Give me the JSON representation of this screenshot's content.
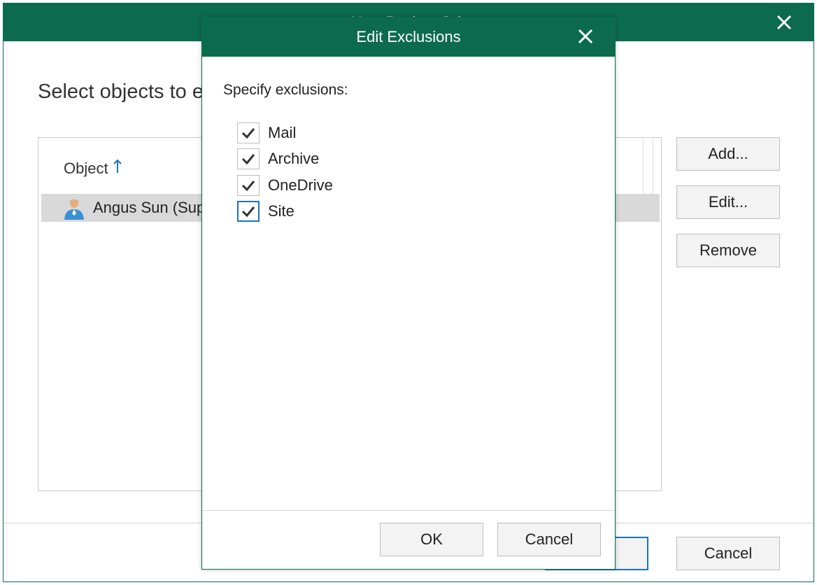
{
  "outer_window": {
    "title": "New Backup Job",
    "heading": "Select objects to e",
    "table": {
      "column_header": "Object",
      "sort_direction": "ascending",
      "rows": [
        {
          "icon": "user-icon",
          "label": "Angus Sun (Sup"
        }
      ]
    },
    "side_buttons": {
      "add": "Add...",
      "edit": "Edit...",
      "remove": "Remove"
    },
    "footer": {
      "cancel": "Cancel"
    }
  },
  "modal": {
    "title": "Edit Exclusions",
    "prompt": "Specify exclusions:",
    "items": [
      {
        "label": "Mail",
        "checked": true
      },
      {
        "label": "Archive",
        "checked": true
      },
      {
        "label": "OneDrive",
        "checked": true
      },
      {
        "label": "Site",
        "checked": true
      }
    ],
    "buttons": {
      "ok": "OK",
      "cancel": "Cancel"
    }
  },
  "colors": {
    "titlebar": "#0d6b4d",
    "accent": "#1a73c9",
    "button_bg": "#f3f3f3"
  }
}
